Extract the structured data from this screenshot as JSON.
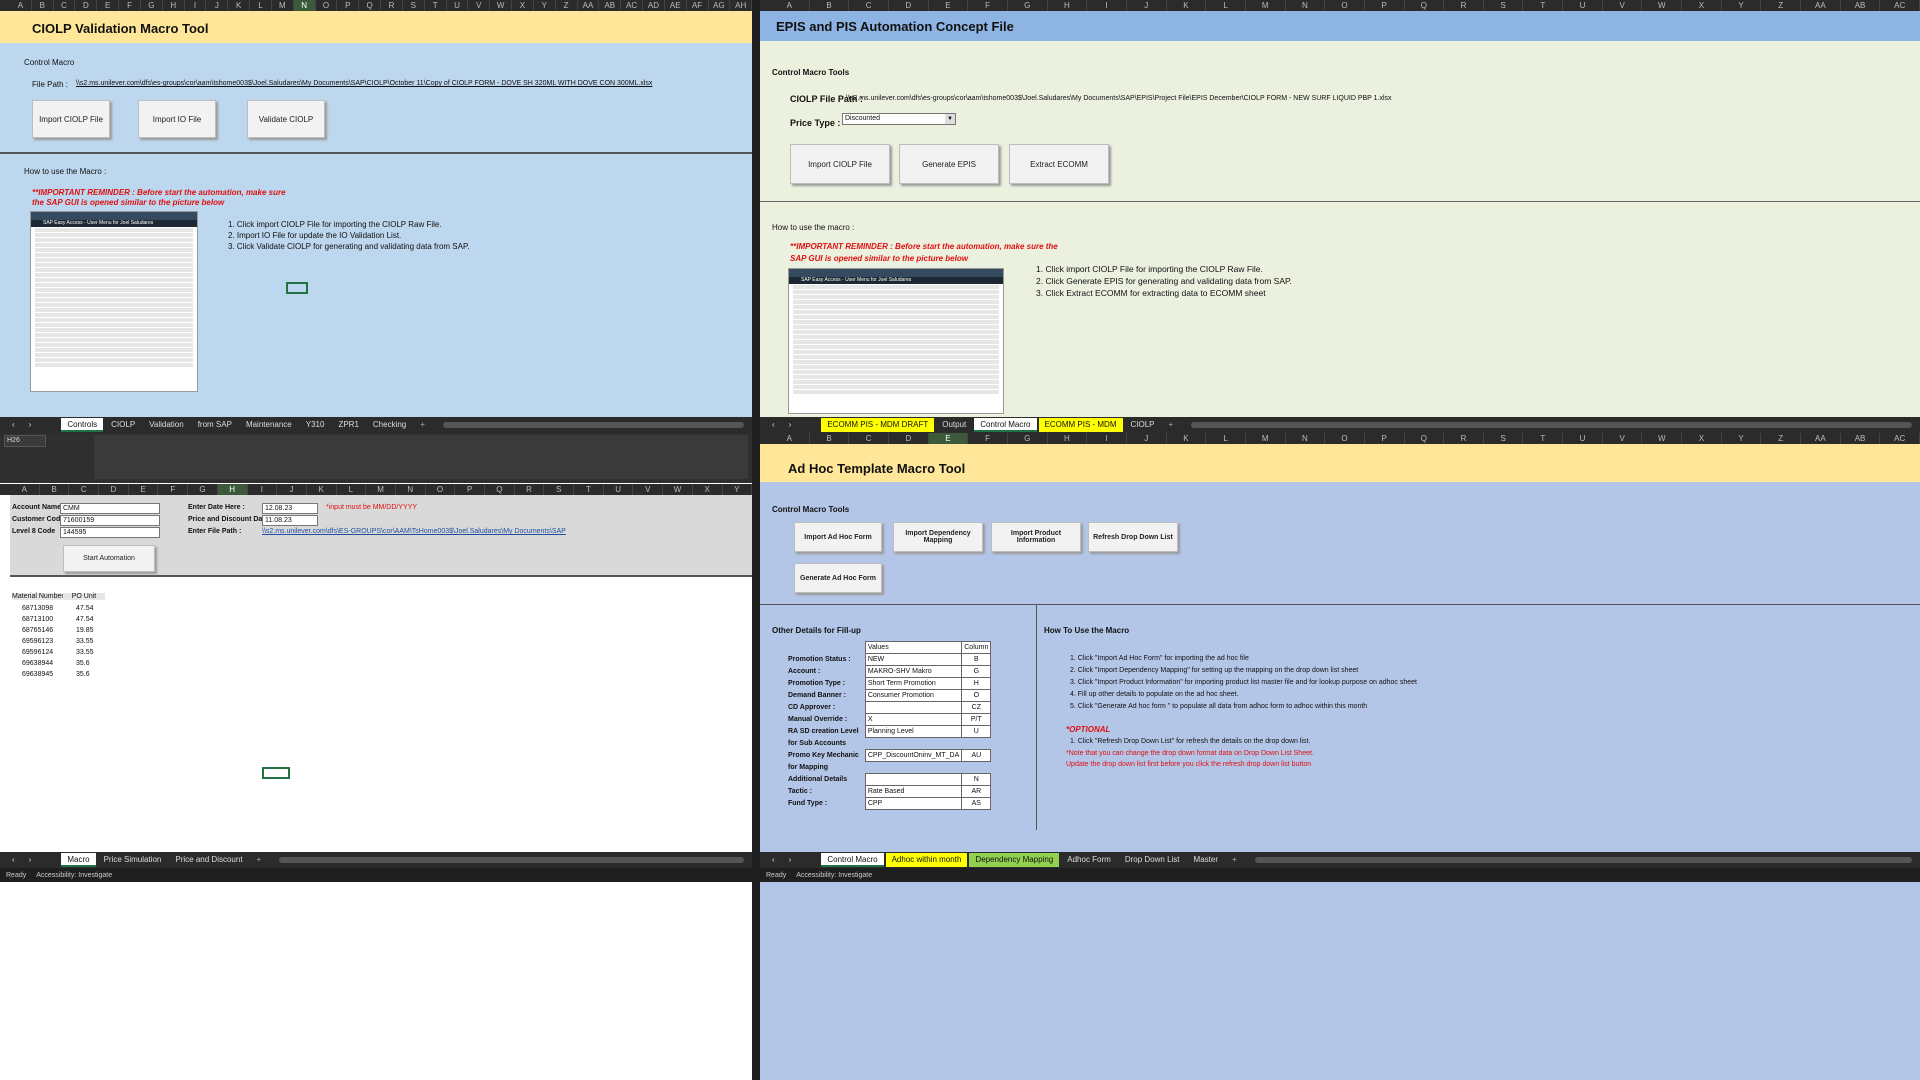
{
  "windows": {
    "ciolp": {
      "title": "CIOLP Validation Macro Tool",
      "section": "Control Macro",
      "file_path_label": "File Path :",
      "file_path_value": "\\\\s2.ms.unilever.com\\dfs\\es-groups\\cor\\aam\\tshome003$\\Joel.Saludares\\My Documents\\SAP\\CIOLP\\October 11\\Copy of CIOLP FORM - DOVE SH 320ML WITH DOVE CON 300ML.xlsx",
      "buttons": [
        "Import CIOLP File",
        "Import IO File",
        "Validate CIOLP"
      ],
      "how_to": "How to use the Macro :",
      "reminder_1": "**IMPORTANT REMINDER : Before start the automation, make sure",
      "reminder_2": "the SAP GUI is opened similar to the picture below",
      "sap_title": "SAP Easy Access  -  User Menu for Joel Saludares",
      "steps": [
        "1. Click import CIOLP File for importing the CIOLP Raw File.",
        "2. Import IO File for update the IO Validation List.",
        "3. Click Validate CIOLP for generating and validating data from SAP."
      ],
      "tabs": [
        "Controls",
        "CIOLP",
        "Validation",
        "from SAP",
        "Maintenance",
        "Y310",
        "ZPR1",
        "Checking",
        "+"
      ],
      "active_tab": "Controls"
    },
    "epis": {
      "title": "EPIS and PIS Automation Concept File",
      "section": "Control Macro Tools",
      "file_path_label": "CIOLP File Path :",
      "file_path_value": "\\\\s2.ms.unilever.com\\dfs\\es-groups\\cor\\aam\\tshome003$\\Joel.Saludares\\My Documents\\SAP\\EPIS\\Project File\\EPIS December\\CIOLP FORM - NEW SURF LIQUID PBP 1.xlsx",
      "price_type_label": "Price Type :",
      "price_type_value": "Discounted",
      "buttons": [
        "Import CIOLP File",
        "Generate EPIS",
        "Extract ECOMM"
      ],
      "how_to": "How to use the macro :",
      "reminder_1": "**IMPORTANT REMINDER : Before start the automation, make sure the",
      "reminder_2": "SAP GUI is opened similar to the picture below",
      "sap_title": "SAP Easy Access  -  User Menu for Joel Saludares",
      "steps": [
        "1. Click import CIOLP File for importing the CIOLP Raw File.",
        "2. Click Generate EPIS for generating and validating data from SAP.",
        "3. Click Extract ECOMM for extracting data to ECOMM sheet"
      ],
      "tabs": [
        "ECOMM PIS - MDM DRAFT",
        "Output",
        "Control Macro",
        "ECOMM PIS - MDM",
        "CIOLP",
        "+"
      ]
    },
    "pricesim": {
      "name_box": "H26",
      "account_label": "Account Name :",
      "account_value": "CMM",
      "customer_label": "Customer Code :",
      "customer_value": "71600159",
      "level_label": "Level 8 Code",
      "level_value": "144595",
      "enter_date_label": "Enter Date Here :",
      "enter_date_value": "12.08.23",
      "price_date_label": "Price and Discount Date :",
      "price_date_value": "11.08.23",
      "file_path_label": "Enter File Path :",
      "file_path_value": "\\\\s2.ms.unilever.com\\dfs\\ES-GROUPS\\cor\\AAM\\TsHome003$\\Joel.Saludares\\My Documents\\SAP",
      "note": "*input must be MM/DD/YYYY",
      "button": "Start Automation",
      "table_headers": [
        "Material Number",
        "PO Unit"
      ],
      "rows": [
        [
          "68713098",
          "47.54"
        ],
        [
          "68713100",
          "47.54"
        ],
        [
          "68765146",
          "19.85"
        ],
        [
          "69596123",
          "33.55"
        ],
        [
          "69596124",
          "33.55"
        ],
        [
          "69638944",
          "35.6"
        ],
        [
          "69638945",
          "35.6"
        ]
      ],
      "tabs": [
        "Macro",
        "Price Simulation",
        "Price and Discount",
        "+"
      ],
      "status": "Ready",
      "accessibility": "Accessibility: Investigate"
    },
    "adhoc": {
      "title": "Ad Hoc Template Macro Tool",
      "section": "Control Macro Tools",
      "buttons": [
        "Import Ad Hoc Form",
        "Import Dependency Mapping",
        "Import Product Information",
        "Refresh Drop Down List",
        "Generate Ad Hoc Form"
      ],
      "other_details": "Other Details for Fill-up",
      "col_values": "Values",
      "col_column": "Column",
      "fields": [
        {
          "label": "Promotion Status :",
          "value": "NEW",
          "col": "B"
        },
        {
          "label": "Account :",
          "value": "MAKRO-SHV Makro",
          "col": "G"
        },
        {
          "label": "Promotion Type :",
          "value": "Short Term Promotion",
          "col": "H"
        },
        {
          "label": "Demand Banner :",
          "value": "Consumer Promotion",
          "col": "O"
        },
        {
          "label": "CD Approver :",
          "value": "",
          "col": "CZ"
        },
        {
          "label": "Manual Override :",
          "value": "X",
          "col": "P/T"
        },
        {
          "label": "RA SD creation Level",
          "value": "Planning Level",
          "col": "U"
        },
        {
          "label": "for Sub Accounts",
          "value": null,
          "col": null
        },
        {
          "label": "Promo Key Mechanic",
          "value": "CPP_DiscountOninv_MT_DA",
          "col": "AU"
        },
        {
          "label": "for Mapping",
          "value": null,
          "col": null
        },
        {
          "label": "Additional Details",
          "value": "",
          "col": "N"
        },
        {
          "label": "Tactic :",
          "value": "Rate Based",
          "col": "AR"
        },
        {
          "label": "Fund Type :",
          "value": "CPP",
          "col": "AS"
        }
      ],
      "how_to": "How To Use the Macro",
      "steps": [
        "1. Click \"Import Ad Hoc Form\" for importing the ad hoc file",
        "2. Click \"Import Dependency Mapping\" for setting up the mapping on the drop down list sheet",
        "3. Click \"Import Product Information\" for importing product list master file and for lookup purpose on adhoc sheet",
        "4. Fill up other details to populate on the ad hoc sheet.",
        "5. Click \"Generate Ad hoc form \" to populate all data from adhoc form to adhoc within this month"
      ],
      "optional": "*OPTIONAL",
      "opt_step": "1. Click \"Refresh Drop Down List\" for refresh the details on the drop down list.",
      "opt_note1": "*Note that you can change the drop down format data on Drop Down List Sheet.",
      "opt_note2": "Update the drop down list first before you click the refresh drop down list button",
      "tabs": [
        "Control Macro",
        "Adhoc within month",
        "Dependency Mapping",
        "Adhoc Form",
        "Drop Down List",
        "Master",
        "+"
      ],
      "status": "Ready",
      "accessibility": "Accessibility: Investigate"
    }
  },
  "colors": {
    "yellow": "#ffe699",
    "blue": "#bdd7ee",
    "sage": "#ebf1de",
    "periwinkle": "#b4c6e7",
    "tab_yellow": "#ffff00",
    "tab_green": "#92d050"
  }
}
